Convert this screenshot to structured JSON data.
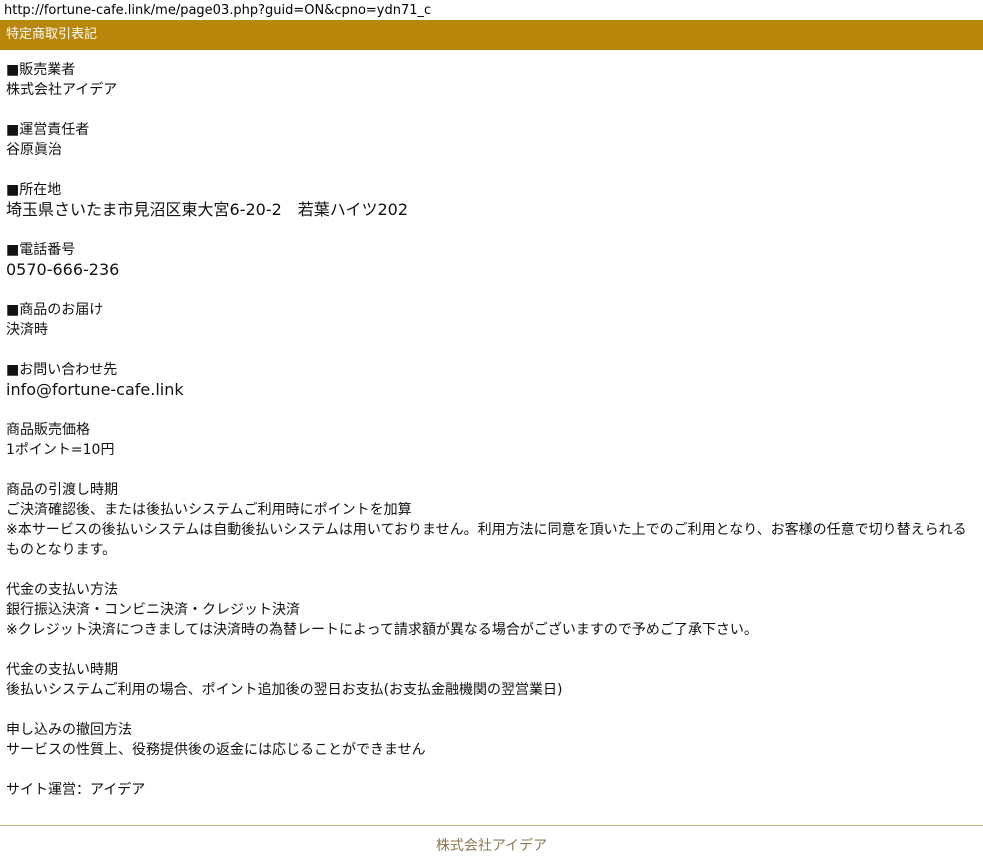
{
  "browser": {
    "url": "http://fortune-cafe.link/me/page03.php?guid=ON&cpno=ydn71_c"
  },
  "header": {
    "title": "特定商取引表記"
  },
  "sections": {
    "seller": {
      "heading": "■販売業者",
      "value": "株式会社アイデア"
    },
    "manager": {
      "heading": "■運営責任者",
      "value": "谷原眞治"
    },
    "address": {
      "heading": "■所在地",
      "value": "埼玉県さいたま市見沼区東大宮6-20-2　若葉ハイツ202"
    },
    "phone": {
      "heading": "■電話番号",
      "value": "0570-666-236"
    },
    "delivery": {
      "heading": "■商品のお届け",
      "value": "決済時"
    },
    "contact": {
      "heading": "■お問い合わせ先",
      "value": "info@fortune-cafe.link"
    },
    "price": {
      "heading": "商品販売価格",
      "value": "1ポイント=10円"
    },
    "handover": {
      "heading": "商品の引渡し時期",
      "line1": "ご決済確認後、または後払いシステムご利用時にポイントを加算",
      "line2": "※本サービスの後払いシステムは自動後払いシステムは用いておりません。利用方法に同意を頂いた上でのご利用となり、お客様の任意で切り替えられるものとなります。"
    },
    "payment_method": {
      "heading": "代金の支払い方法",
      "line1": "銀行振込決済・コンビニ決済・クレジット決済",
      "line2": "※クレジット決済につきましては決済時の為替レートによって請求額が異なる場合がございますので予めご了承下さい。"
    },
    "payment_timing": {
      "heading": "代金の支払い時期",
      "value": "後払いシステムご利用の場合、ポイント追加後の翌日お支払(お支払金融機関の翌営業日)"
    },
    "cancellation": {
      "heading": "申し込みの撤回方法",
      "value": "サービスの性質上、役務提供後の返金には応じることができません"
    },
    "operator": {
      "value": "サイト運営：アイデア"
    }
  },
  "footer": {
    "company": "株式会社アイデア"
  }
}
